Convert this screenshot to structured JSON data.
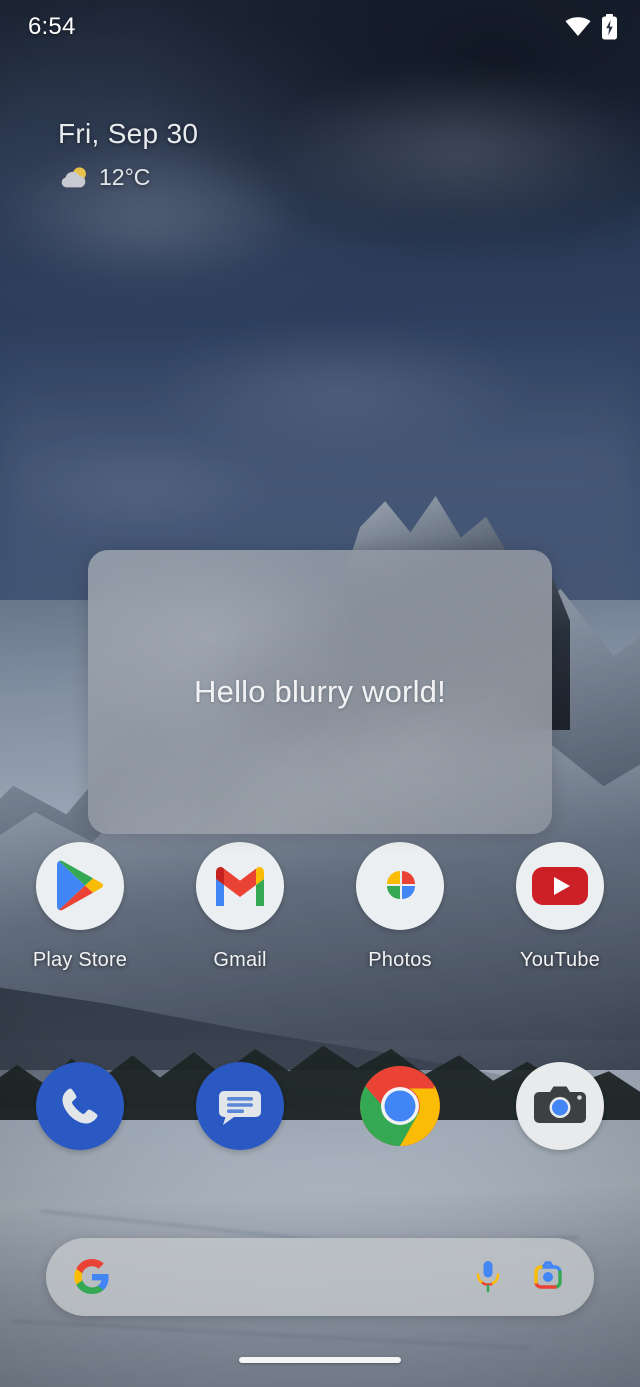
{
  "status_bar": {
    "time": "6:54",
    "icons": [
      {
        "name": "wifi-icon",
        "label": "Wi-Fi connected"
      },
      {
        "name": "battery-charging-icon",
        "label": "Battery charging"
      }
    ]
  },
  "smartspace_widget": {
    "date": "Fri, Sep 30",
    "temperature": "12°C",
    "weather_icon": "partly-cloudy-icon"
  },
  "blur_panel": {
    "text": "Hello blurry world!"
  },
  "app_grid": {
    "apps": [
      {
        "label": "Play Store",
        "icon": "play-store-icon"
      },
      {
        "label": "Gmail",
        "icon": "gmail-icon"
      },
      {
        "label": "Photos",
        "icon": "google-photos-icon"
      },
      {
        "label": "YouTube",
        "icon": "youtube-icon"
      }
    ]
  },
  "dock": {
    "apps": [
      {
        "label": "Phone",
        "icon": "phone-icon"
      },
      {
        "label": "Messages",
        "icon": "messages-icon"
      },
      {
        "label": "Chrome",
        "icon": "chrome-icon"
      },
      {
        "label": "Camera",
        "icon": "camera-icon"
      }
    ]
  },
  "search_bar": {
    "value": "",
    "placeholder": "",
    "logo_icon": "google-g-icon",
    "voice_icon": "assistant-microphone-icon",
    "lens_icon": "google-lens-icon"
  },
  "navigation": {
    "gesture_pill": "home-gesture-pill"
  },
  "colors": {
    "google_blue": "#4285F4",
    "google_red": "#EA4335",
    "google_yellow": "#FBBC05",
    "google_green": "#34A853",
    "youtube_red": "#CC2026",
    "dock_blue": "#2B59C3",
    "icon_circle": "#ECEFF1",
    "panel_text": "#F2F3F5"
  }
}
